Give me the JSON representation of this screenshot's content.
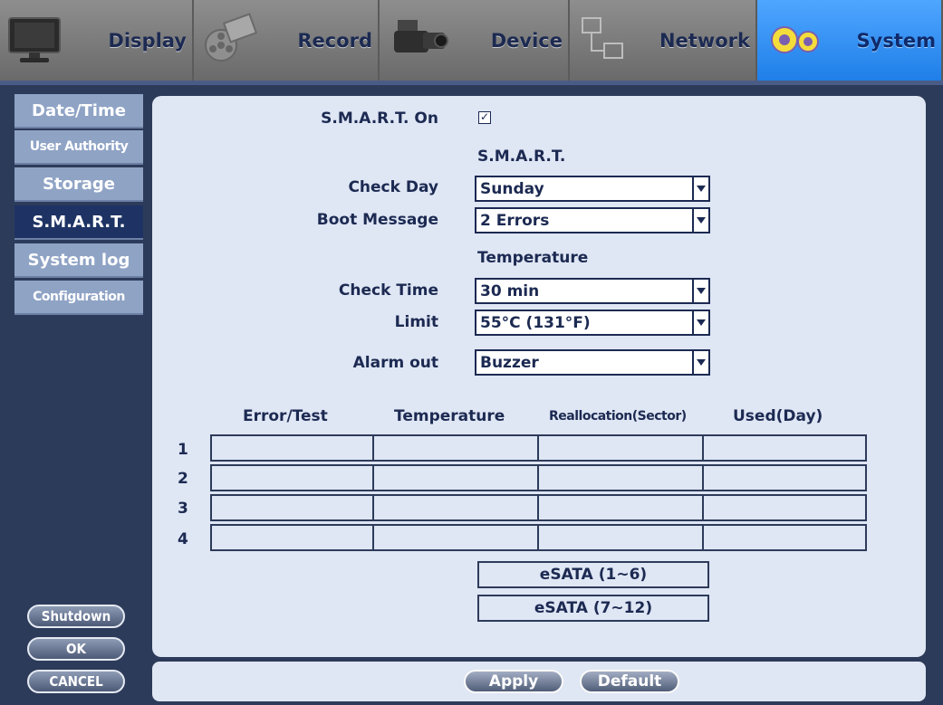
{
  "tabs": [
    {
      "label": "Display",
      "icon": "monitor-icon"
    },
    {
      "label": "Record",
      "icon": "film-reel-icon"
    },
    {
      "label": "Device",
      "icon": "camcorder-icon"
    },
    {
      "label": "Network",
      "icon": "network-icon"
    },
    {
      "label": "System",
      "icon": "gears-icon",
      "active": true
    }
  ],
  "sidebar": {
    "items": [
      {
        "label": "Date/Time"
      },
      {
        "label": "User Authority"
      },
      {
        "label": "Storage"
      },
      {
        "label": "S.M.A.R.T.",
        "active": true
      },
      {
        "label": "System log"
      },
      {
        "label": "Configuration"
      }
    ],
    "shutdown_label": "Shutdown",
    "ok_label": "OK",
    "cancel_label": "CANCEL"
  },
  "smart": {
    "on_label": "S.M.A.R.T. On",
    "on_checked": true,
    "section_smart": "S.M.A.R.T.",
    "check_day_label": "Check Day",
    "check_day_value": "Sunday",
    "boot_message_label": "Boot Message",
    "boot_message_value": "2 Errors",
    "section_temperature": "Temperature",
    "check_time_label": "Check Time",
    "check_time_value": "30 min",
    "limit_label": "Limit",
    "limit_value": "55°C (131°F)",
    "alarm_out_label": "Alarm out",
    "alarm_out_value": "Buzzer"
  },
  "table": {
    "columns": [
      "Error/Test",
      "Temperature",
      "Reallocation(Sector)",
      "Used(Day)"
    ],
    "rows": [
      "1",
      "2",
      "3",
      "4"
    ]
  },
  "esata": {
    "range1": "eSATA (1~6)",
    "range2": "eSATA (7~12)"
  },
  "footer": {
    "apply_label": "Apply",
    "default_label": "Default"
  },
  "colors": {
    "active_tab": "#1f7fe8",
    "panel_bg": "#dfe6f4",
    "text": "#1c2a52",
    "sidebar_active": "#1e3364"
  }
}
